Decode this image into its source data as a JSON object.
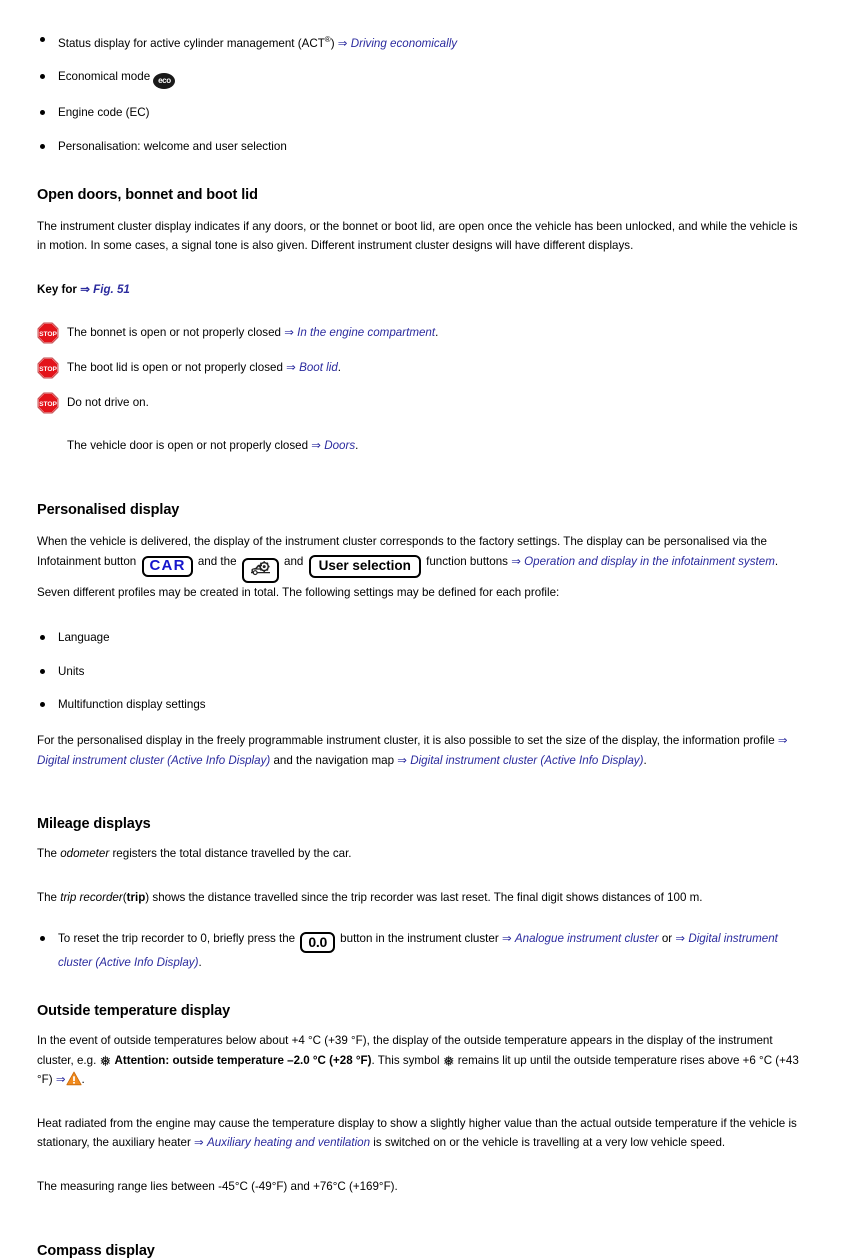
{
  "colors": {
    "link": "#2b2b9e",
    "car_button_text": "#1515cc",
    "stop_icon_red": "#e3141b",
    "warning_orange": "#f08a1e",
    "text": "#000000",
    "background": "#ffffff"
  },
  "top_bullets": [
    {
      "text_before": "Status display for active cylinder management (ACT",
      "superscript": "®",
      "text_after": ")",
      "arrow": "⇒",
      "link": "Driving economically"
    },
    {
      "text_before": "Economical mode",
      "icon": "eco-badge",
      "icon_label": "eco"
    },
    {
      "text_before": "Engine code (EC)"
    },
    {
      "text_before": "Personalisation: welcome and user selection"
    }
  ],
  "section_open_doors": {
    "heading": "Open doors, bonnet and boot lid",
    "paragraph": "The instrument cluster display indicates if any doors, or the bonnet or boot lid, are open once the vehicle has been unlocked, and while the vehicle is in motion. In some cases, a signal tone is also given. Different instrument cluster designs will have different displays.",
    "key_label": "Key for",
    "key_arrow": "⇒",
    "key_link": "Fig. 51",
    "key_rows": [
      {
        "icon": "stop-icon",
        "icon_label": "STOP",
        "text": "The bonnet is open or not properly closed",
        "arrow": "⇒",
        "link": "In the engine compartment",
        "trailing": "."
      },
      {
        "icon": "stop-icon",
        "icon_label": "STOP",
        "text": "The boot lid is open or not properly closed",
        "arrow": "⇒",
        "link": "Boot lid",
        "trailing": "."
      },
      {
        "icon": "stop-icon",
        "icon_label": "STOP",
        "text": "Do not drive on.",
        "arrow": "",
        "link": "",
        "trailing": ""
      }
    ],
    "plain_row": {
      "text": "The vehicle door is open or not properly closed",
      "arrow": "⇒",
      "link": "Doors",
      "trailing": "."
    }
  },
  "section_personalised": {
    "heading": "Personalised display",
    "para_part1": "When the vehicle is delivered, the display of the instrument cluster corresponds to the factory settings. The display can be personalised via the Infotainment button",
    "button_car": "CAR",
    "para_part2": "and the",
    "button_setup_icon": "car-setup-icon",
    "para_part3": "and",
    "button_user_selection": "User selection",
    "para_part4": "function buttons",
    "arrow1": "⇒",
    "link1": "Operation and display in the infotainment system",
    "para_part5": ". Seven different profiles may be created in total. The following settings may be defined for each profile:",
    "bullets": [
      "Language",
      "Units",
      "Multifunction display settings"
    ],
    "closing_part1": "For the personalised display in the freely programmable instrument cluster, it is also possible to set the size of the display, the information profile",
    "closing_arrow1": "⇒",
    "closing_link1": "Digital instrument cluster (Active Info Display)",
    "closing_part2": "and the navigation map",
    "closing_arrow2": "⇒",
    "closing_link2": "Digital instrument cluster (Active Info Display)",
    "closing_part3": "."
  },
  "section_mileage": {
    "heading": "Mileage displays",
    "para1_part1": "The",
    "para1_italic": "odometer",
    "para1_part2": "registers the total distance travelled by the car.",
    "para2_part1": "The",
    "para2_italic": "trip recorder",
    "para2_open": "(",
    "para2_bold": "trip",
    "para2_close": ")",
    "para2_part2": "shows the distance travelled since the trip recorder was last reset. The final digit shows distances of 100 m.",
    "bullet_part1": "To reset the trip recorder to 0, briefly press the",
    "bullet_button": "0.0",
    "bullet_part2": "button in the instrument cluster",
    "bullet_arrow1": "⇒",
    "bullet_link1": "Analogue instrument cluster",
    "bullet_or": "or",
    "bullet_arrow2": "⇒",
    "bullet_link2": "Digital instrument cluster (Active Info Display)",
    "bullet_part3": "."
  },
  "section_outside_temp": {
    "heading": "Outside temperature display",
    "para_part1": "In the event of outside temperatures below about +4 °C (+39 °F), the display of the outside temperature appears in the display of the instrument cluster, e.g.",
    "snowflake1": "❅",
    "bold_text": "Attention: outside temperature –2.0 °C (+28 °F)",
    "para_part2": ". This symbol",
    "snowflake2": "❅",
    "para_part3": "remains lit up until the outside temperature rises above +6 °C (+43 °F)",
    "arrow": "⇒",
    "warning_icon": "warning-triangle-icon",
    "para_part4": ".",
    "para2_part1": "Heat radiated from the engine may cause the temperature display to show a slightly higher value than the actual outside temperature if the vehicle is stationary, the auxiliary heater",
    "para2_arrow": "⇒",
    "para2_link": "Auxiliary heating and ventilation",
    "para2_part2": "is switched on or the vehicle is travelling at a very low vehicle speed.",
    "para3": "The measuring range lies between -45°C (-49°F) and +76°C (+169°F)."
  },
  "section_compass": {
    "heading": "Compass display"
  }
}
